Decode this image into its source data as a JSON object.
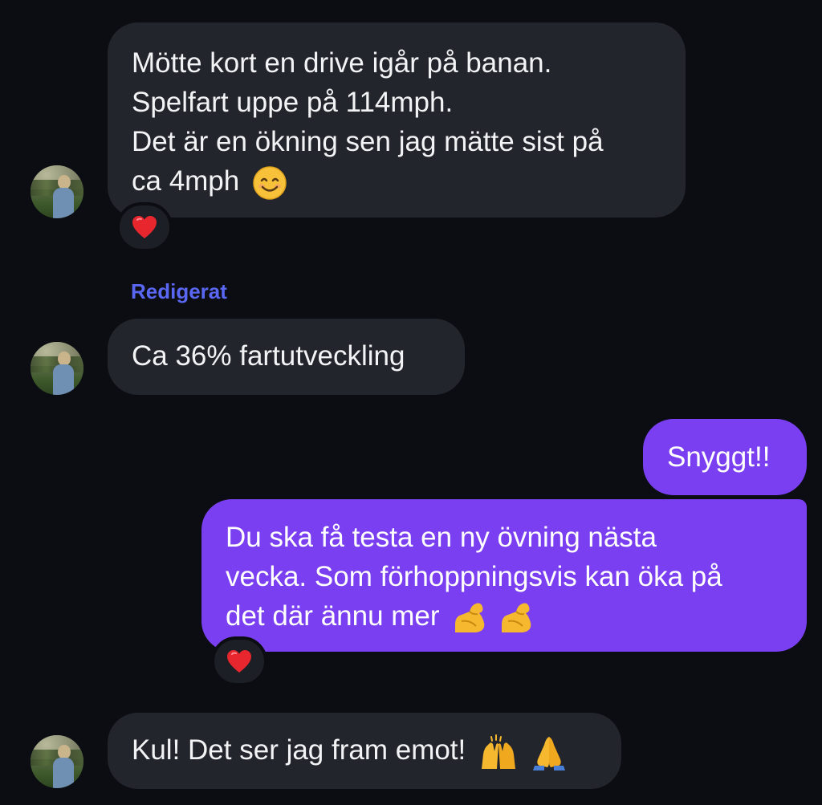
{
  "conversation": {
    "messages": [
      {
        "direction": "incoming",
        "lines": [
          "Mötte kort en drive igår på banan.",
          "Spelfart uppe på 114mph.",
          "Det är en ökning sen jag mätte sist på",
          "ca 4mph"
        ],
        "trailing_emoji": "smiling-face-icon",
        "reaction": "red-heart-icon"
      },
      {
        "direction": "incoming",
        "edited_label": "Redigerat",
        "lines": [
          "Ca 36% fartutveckling"
        ]
      },
      {
        "direction": "outgoing",
        "lines": [
          "Snyggt!!"
        ]
      },
      {
        "direction": "outgoing",
        "lines": [
          "Du ska få testa en ny övning nästa",
          "vecka. Som förhoppningsvis kan öka på",
          "det där ännu mer"
        ],
        "trailing_emoji": [
          "flexed-biceps-icon",
          "flexed-biceps-icon"
        ],
        "reaction": "red-heart-icon"
      },
      {
        "direction": "incoming",
        "lines": [
          "Kul! Det ser jag fram emot!"
        ],
        "trailing_emoji": [
          "raising-hands-icon",
          "folded-hands-icon"
        ]
      }
    ]
  },
  "colors": {
    "background": "#0b0d12",
    "incoming_bubble": "#22252c",
    "outgoing_bubble": "#7b3ff2",
    "edited_label": "#5a67f2",
    "heart": "#e8262e"
  }
}
